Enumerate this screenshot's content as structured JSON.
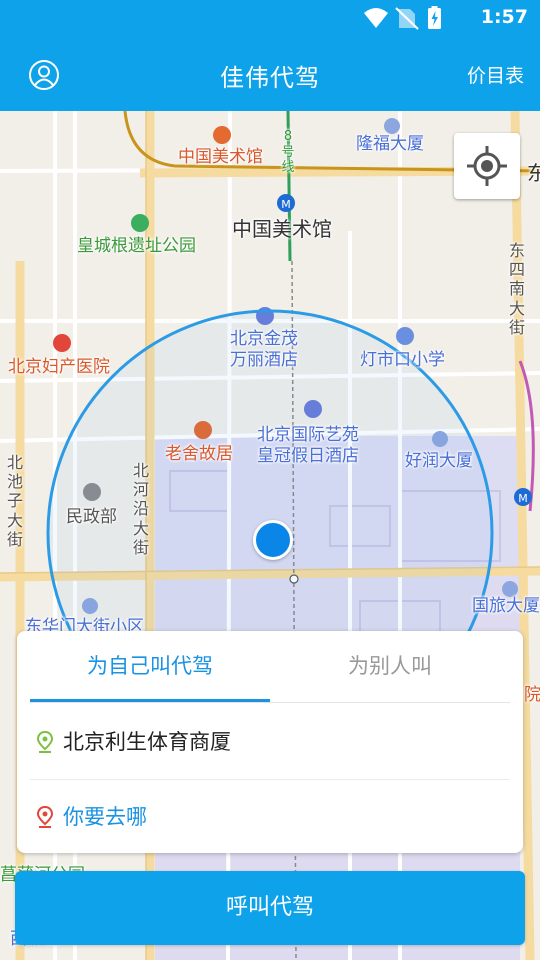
{
  "status_bar": {
    "time": "1:57",
    "icons": [
      "wifi-icon",
      "no-sim-icon",
      "battery-charging-icon"
    ]
  },
  "app_bar": {
    "title": "佳伟代驾",
    "price_list": "价目表",
    "left_icon": "profile-icon"
  },
  "colors": {
    "brand": "#0ea2ea",
    "accent": "#1a93e3",
    "range_circle": "#2b9be6"
  },
  "map": {
    "labels": {
      "art_museum_poi": "中国美术馆",
      "line_8": "8号线",
      "longfu": "隆福大厦",
      "dong": "东",
      "art_museum": "中国美术馆",
      "huangcheng_park": "皇城根遗址公园",
      "dongsi_south": "东四南大街",
      "jinmao_hotel_1": "北京金茂",
      "jinmao_hotel_2": "万丽酒店",
      "dengshikou_school": "灯市口小学",
      "maternity_hospital": "北京妇产医院",
      "laoshe_house": "老舍故居",
      "crowne_plaza_1": "北京国际艺苑",
      "crowne_plaza_2": "皇冠假日酒店",
      "haorun": "好润大厦",
      "beichizi": "北池子大街",
      "civil_affairs": "民政部",
      "beiheyan": "北河沿大街",
      "guolv": "国旅大厦",
      "donghuamen": "东华门大街小区",
      "yuan": "院",
      "park_bottom": "菖蒲河公园",
      "bottom_left": "西城区"
    }
  },
  "card": {
    "tabs": {
      "self": "为自己叫代驾",
      "other": "为别人叫"
    },
    "from_location": "北京利生体育商厦",
    "to_placeholder": "你要去哪"
  },
  "call_button": "呼叫代驾"
}
